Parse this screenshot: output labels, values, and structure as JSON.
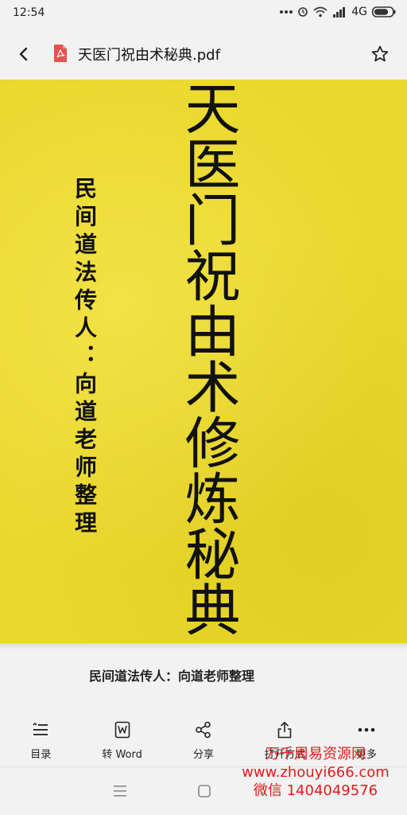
{
  "status_bar": {
    "time": "12:54",
    "network": "4G",
    "icons": [
      "more-dots-icon",
      "alarm-icon",
      "wifi-icon",
      "signal-icon",
      "battery-icon"
    ]
  },
  "header": {
    "back_icon": "chevron-left-icon",
    "file_icon": "pdf-file-icon",
    "title": "天医门祝由术秘典.pdf",
    "star_icon": "star-outline-icon"
  },
  "document": {
    "main_title": "天医门祝由术修炼秘典",
    "subtitle": "民间道法传人：向道老师整理",
    "page_color": "#ead82c"
  },
  "caption": "民间道法传人：向道老师整理",
  "toolbar": {
    "items": [
      {
        "label": "目录",
        "icon": "list-icon"
      },
      {
        "label": "转 Word",
        "icon": "word-icon"
      },
      {
        "label": "分享",
        "icon": "share-icon"
      },
      {
        "label": "打开方式",
        "icon": "open-with-icon"
      },
      {
        "label": "更多",
        "icon": "more-icon"
      }
    ]
  },
  "nav_bar": {
    "icons": [
      "menu-icon",
      "home-icon"
    ]
  },
  "watermark": {
    "line1": "万千周易资源网",
    "line2": "www.zhouyi666.com",
    "line3": "微信 1404049576",
    "color": "#e21b1b"
  }
}
